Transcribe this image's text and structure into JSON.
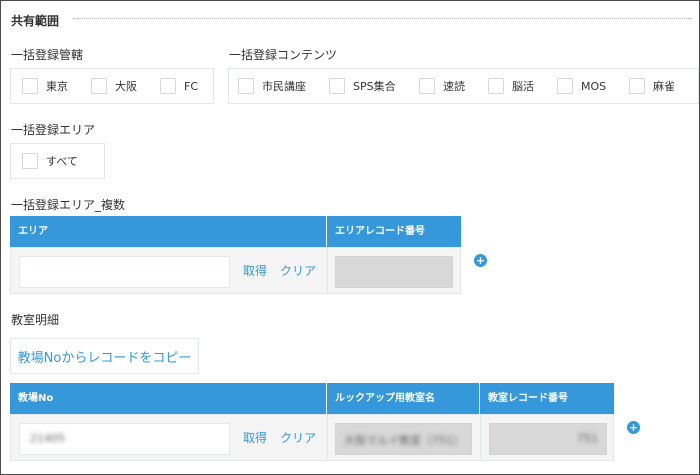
{
  "section": {
    "title": "共有範囲"
  },
  "bulk_district": {
    "label": "一括登録管轄",
    "options": [
      {
        "label": "東京",
        "checked": false
      },
      {
        "label": "大阪",
        "checked": false
      },
      {
        "label": "FC",
        "checked": false
      }
    ]
  },
  "bulk_contents": {
    "label": "一括登録コンテンツ",
    "options": [
      {
        "label": "市民講座",
        "checked": false
      },
      {
        "label": "SPS集合",
        "checked": false
      },
      {
        "label": "速読",
        "checked": false
      },
      {
        "label": "脳活",
        "checked": false
      },
      {
        "label": "MOS",
        "checked": false
      },
      {
        "label": "麻雀",
        "checked": false
      }
    ]
  },
  "bulk_area": {
    "label": "一括登録エリア",
    "options": [
      {
        "label": "すべて",
        "checked": false
      }
    ]
  },
  "bulk_area_multi": {
    "label": "一括登録エリア_複数",
    "columns": [
      "エリア",
      "エリアレコード番号"
    ],
    "row": {
      "area_value": "",
      "get_label": "取得",
      "clear_label": "クリア"
    },
    "add_icon": "plus-circle-icon"
  },
  "classroom_detail": {
    "label": "教室明細",
    "copy_button": "教場Noからレコードをコピー",
    "columns": [
      "教場No",
      "ルックアップ用教室名",
      "教室レコード番号"
    ],
    "row": {
      "classroom_no": "21405",
      "get_label": "取得",
      "clear_label": "クリア",
      "lookup_name": "大阪マルイ教室（751）",
      "record_no": "751"
    },
    "add_icon": "plus-circle-icon"
  },
  "colors": {
    "accent": "#3498db",
    "border": "#e3e7e8",
    "readonly": "#d8d8d8"
  }
}
